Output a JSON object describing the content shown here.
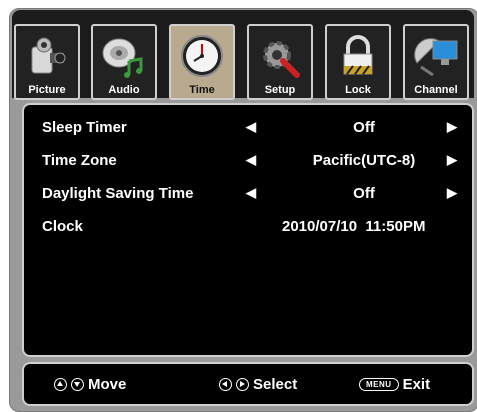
{
  "tabs": [
    {
      "label": "Picture",
      "icon": "camcorder-icon"
    },
    {
      "label": "Audio",
      "icon": "speaker-icon"
    },
    {
      "label": "Time",
      "icon": "clock-icon",
      "active": true
    },
    {
      "label": "Setup",
      "icon": "gear-wrench-icon"
    },
    {
      "label": "Lock",
      "icon": "padlock-icon"
    },
    {
      "label": "Channel",
      "icon": "satellite-dish-icon"
    }
  ],
  "settings": {
    "sleep_timer": {
      "label": "Sleep Timer",
      "value": "Off"
    },
    "time_zone": {
      "label": "Time Zone",
      "value": "Pacific(UTC-8)"
    },
    "daylight_saving": {
      "label": "Daylight Saving Time",
      "value": "Off"
    },
    "clock": {
      "label": "Clock",
      "value": "2010/07/10  11:50PM"
    }
  },
  "footer": {
    "move": "Move",
    "select": "Select",
    "menu_key": "MENU",
    "exit": "Exit"
  },
  "colors": {
    "active_tab": "#b8a98f",
    "panel": "#000000",
    "frame": "#9a9a9a"
  }
}
